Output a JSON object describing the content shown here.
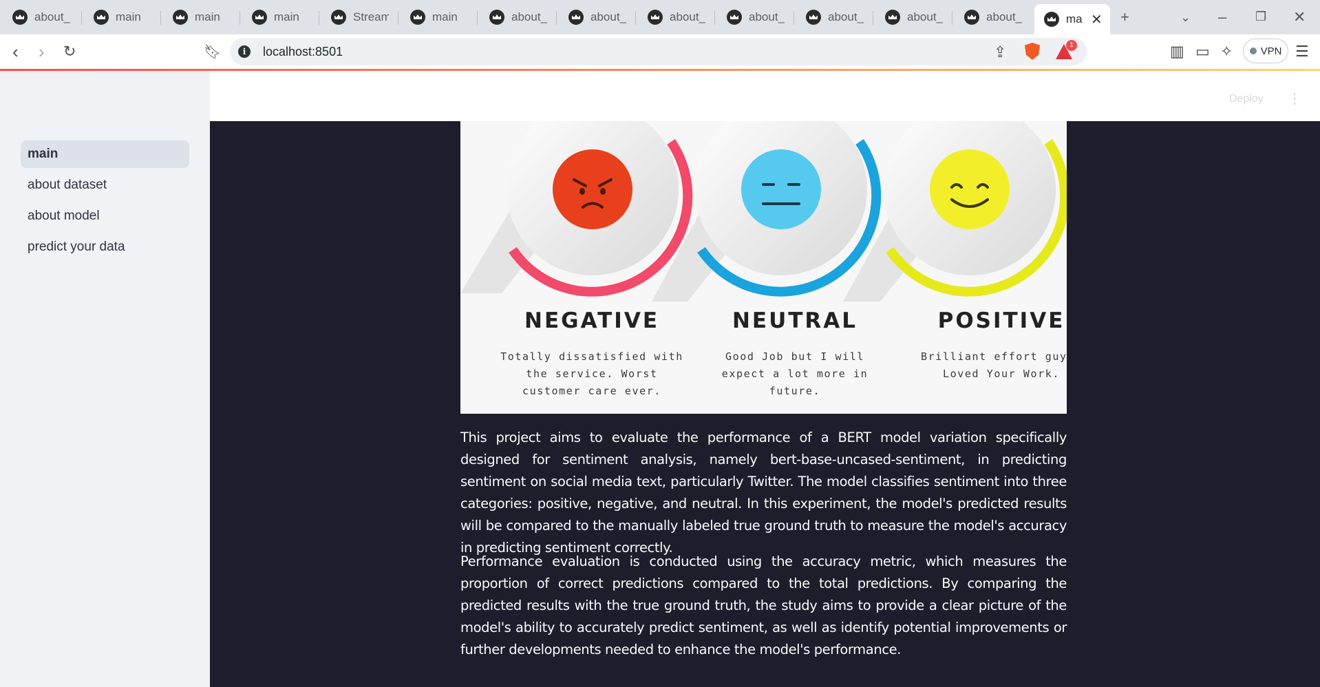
{
  "browser": {
    "tabs": [
      {
        "label": "about_c"
      },
      {
        "label": "main"
      },
      {
        "label": "main"
      },
      {
        "label": "main"
      },
      {
        "label": "Streaml"
      },
      {
        "label": "main"
      },
      {
        "label": "about_d"
      },
      {
        "label": "about_d"
      },
      {
        "label": "about_d"
      },
      {
        "label": "about_d"
      },
      {
        "label": "about_n"
      },
      {
        "label": "about_n"
      },
      {
        "label": "about_n"
      },
      {
        "label": "mai"
      }
    ],
    "url": "localhost:8501",
    "rewards_badge": "1",
    "vpn_label": "VPN"
  },
  "sidebar": {
    "items": [
      {
        "label": "main",
        "active": true
      },
      {
        "label": "about dataset"
      },
      {
        "label": "about model"
      },
      {
        "label": "predict your data"
      }
    ]
  },
  "header": {
    "deploy_label": "Deploy"
  },
  "banner": {
    "negative": {
      "title": "NEGATIVE",
      "desc": "Totally dissatisfied with the service. Worst customer care ever.",
      "color": "#f24a6b"
    },
    "neutral": {
      "title": "NEUTRAL",
      "desc": "Good Job but I will expect a lot more in future.",
      "color": "#1aa3dc"
    },
    "positive": {
      "title": "POSITIVE",
      "desc": "Brilliant effort guys! Loved Your Work.",
      "color": "#e6ea1c"
    }
  },
  "content": {
    "paragraph_1": "This project aims to evaluate the performance of a BERT model variation specifically designed for sentiment analysis, namely bert-base-uncased-sentiment, in predicting sentiment on social media text, particularly Twitter. The model classifies sentiment into three categories: positive, negative, and neutral. In this experiment, the model's predicted results will be compared to the manually labeled true ground truth to measure the model's accuracy in predicting sentiment correctly.",
    "paragraph_2": "Performance evaluation is conducted using the accuracy metric, which measures the proportion of correct predictions compared to the total predictions. By comparing the predicted results with the true ground truth, the study aims to provide a clear picture of the model's ability to accurately predict sentiment, as well as identify potential improvements or further developments needed to enhance the model's performance."
  }
}
